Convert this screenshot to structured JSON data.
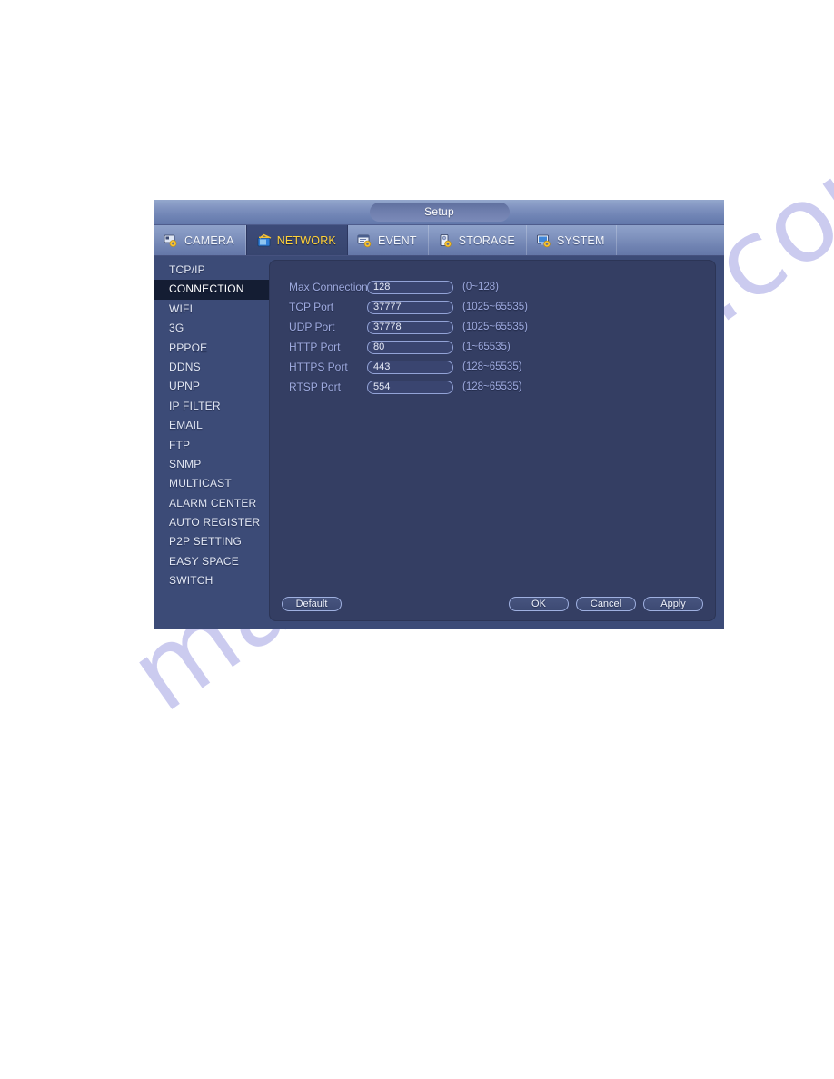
{
  "window": {
    "title": "Setup"
  },
  "tabs": [
    {
      "label": "CAMERA",
      "icon": "camera-gear-icon",
      "active": false
    },
    {
      "label": "NETWORK",
      "icon": "network-icon",
      "active": true
    },
    {
      "label": "EVENT",
      "icon": "event-gear-icon",
      "active": false
    },
    {
      "label": "STORAGE",
      "icon": "storage-gear-icon",
      "active": false
    },
    {
      "label": "SYSTEM",
      "icon": "system-gear-icon",
      "active": false
    }
  ],
  "sidebar": {
    "items": [
      {
        "label": "TCP/IP",
        "selected": false
      },
      {
        "label": "CONNECTION",
        "selected": true
      },
      {
        "label": "WIFI",
        "selected": false
      },
      {
        "label": "3G",
        "selected": false
      },
      {
        "label": "PPPOE",
        "selected": false
      },
      {
        "label": "DDNS",
        "selected": false
      },
      {
        "label": "UPNP",
        "selected": false
      },
      {
        "label": "IP FILTER",
        "selected": false
      },
      {
        "label": "EMAIL",
        "selected": false
      },
      {
        "label": "FTP",
        "selected": false
      },
      {
        "label": "SNMP",
        "selected": false
      },
      {
        "label": "MULTICAST",
        "selected": false
      },
      {
        "label": "ALARM CENTER",
        "selected": false
      },
      {
        "label": "AUTO REGISTER",
        "selected": false
      },
      {
        "label": "P2P SETTING",
        "selected": false
      },
      {
        "label": "EASY SPACE",
        "selected": false
      },
      {
        "label": "SWITCH",
        "selected": false
      }
    ]
  },
  "form": {
    "fields": [
      {
        "label": "Max Connection",
        "value": "128",
        "hint": "(0~128)"
      },
      {
        "label": "TCP Port",
        "value": "37777",
        "hint": "(1025~65535)"
      },
      {
        "label": "UDP Port",
        "value": "37778",
        "hint": "(1025~65535)"
      },
      {
        "label": "HTTP Port",
        "value": "80",
        "hint": "(1~65535)"
      },
      {
        "label": "HTTPS Port",
        "value": "443",
        "hint": "(128~65535)"
      },
      {
        "label": "RTSP Port",
        "value": "554",
        "hint": "(128~65535)"
      }
    ]
  },
  "footer": {
    "default_label": "Default",
    "ok_label": "OK",
    "cancel_label": "Cancel",
    "apply_label": "Apply"
  },
  "watermark": {
    "text": "manualshive.com",
    "color": "#c9c9ef"
  },
  "colors": {
    "window_bg": "#3a4670",
    "sidebar_bg": "#3c4b77",
    "panel_bg": "#343e63",
    "selected_item_bg": "#141d33",
    "active_tab_text": "#ffd23b",
    "label_text": "#9fabe0"
  }
}
